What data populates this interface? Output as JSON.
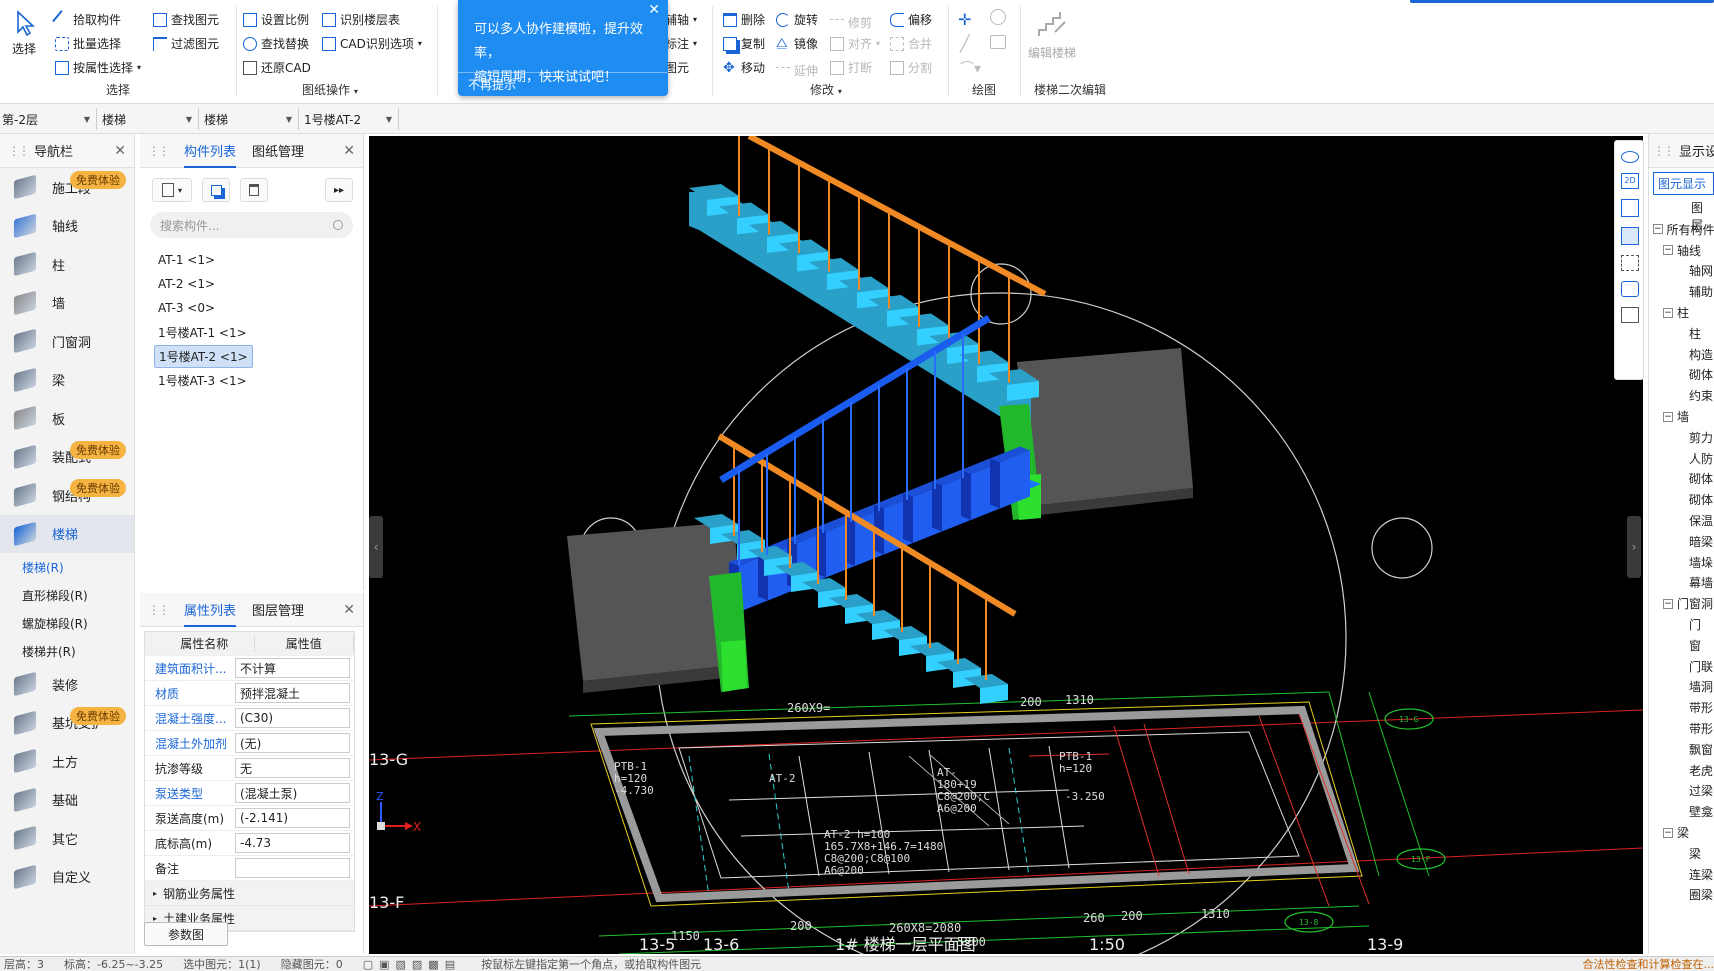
{
  "ribbon": {
    "select": {
      "big": "选择",
      "pick": "拾取构件",
      "batch": "批量选择",
      "by_attr": "按属性选择",
      "find": "查找图元",
      "filter": "过滤图元",
      "group": "选择"
    },
    "drawing": {
      "scale": "设置比例",
      "find_replace": "查找替换",
      "restore_cad": "还原CAD",
      "floor_table": "识别楼层表",
      "cad_options": "CAD识别选项",
      "group": "图纸操作"
    },
    "partial": {
      "axis": "辅轴",
      "dim": "标注",
      "elem": "图元"
    },
    "modify": {
      "delete": "删除",
      "rotate": "旋转",
      "trim": "修剪",
      "offset": "偏移",
      "copy": "复制",
      "mirror": "镜像",
      "align": "对齐",
      "merge": "合并",
      "move": "移动",
      "extend": "延伸",
      "break": "打断",
      "split": "分割",
      "group": "修改"
    },
    "draw": {
      "group": "绘图"
    },
    "stair_edit": {
      "btn": "编辑楼梯",
      "group": "楼梯二次编辑"
    }
  },
  "popup": {
    "line1": "可以多人协作建模啦，提升效率，",
    "line2": "缩短周期，快来试试吧！",
    "dismiss": "不再提示"
  },
  "selectors": [
    "第-2层",
    "楼梯",
    "楼梯",
    "1号楼AT-2"
  ],
  "nav": {
    "title": "导航栏",
    "badge": "免费体验",
    "items": [
      {
        "label": "施工段",
        "badge": true
      },
      {
        "label": "轴线"
      },
      {
        "label": "柱"
      },
      {
        "label": "墙"
      },
      {
        "label": "门窗洞"
      },
      {
        "label": "梁"
      },
      {
        "label": "板"
      },
      {
        "label": "装配式",
        "badge": true
      },
      {
        "label": "钢结构",
        "badge": true
      },
      {
        "label": "楼梯",
        "active": true
      },
      {
        "label": "装修"
      },
      {
        "label": "基坑支护",
        "badge": true
      },
      {
        "label": "土方"
      },
      {
        "label": "基础"
      },
      {
        "label": "其它"
      },
      {
        "label": "自定义"
      }
    ],
    "subitems": [
      "楼梯(R)",
      "直形梯段(R)",
      "螺旋梯段(R)",
      "楼梯井(R)"
    ]
  },
  "components": {
    "tab1": "构件列表",
    "tab2": "图纸管理",
    "search_placeholder": "搜索构件...",
    "items": [
      "AT-1 <1>",
      "AT-2 <1>",
      "AT-3 <0>",
      "1号楼AT-1 <1>",
      "1号楼AT-2 <1>",
      "1号楼AT-3 <1>"
    ],
    "selected_index": 4
  },
  "properties": {
    "tab1": "属性列表",
    "tab2": "图层管理",
    "col_name": "属性名称",
    "col_value": "属性值",
    "rows": [
      {
        "k": "建筑面积计...",
        "v": "不计算",
        "link": true
      },
      {
        "k": "材质",
        "v": "预拌混凝土",
        "link": true
      },
      {
        "k": "混凝土强度...",
        "v": "(C30)",
        "link": true
      },
      {
        "k": "混凝土外加剂",
        "v": "(无)",
        "link": true
      },
      {
        "k": "抗渗等级",
        "v": "无"
      },
      {
        "k": "泵送类型",
        "v": "(混凝土泵)",
        "link": true
      },
      {
        "k": "泵送高度(m)",
        "v": "(-2.141)"
      },
      {
        "k": "底标高(m)",
        "v": "-4.73"
      },
      {
        "k": "备注",
        "v": ""
      }
    ],
    "groups": [
      "钢筋业务属性",
      "土建业务属性"
    ],
    "param_btn": "参数图"
  },
  "viewport": {
    "axis_labels": [
      "13-G",
      "13-F",
      "13-5",
      "13-6",
      "13-9"
    ],
    "dims": [
      "260X9=",
      "200",
      "1310",
      "260X8=2080",
      "1150",
      "200",
      "260",
      "200",
      "1310",
      "5200"
    ],
    "cad_texts": [
      "PTB-1",
      "h=120",
      "-4.730",
      "AT-2",
      "PTB-1",
      "h=120",
      "-3.250",
      "AT-2 h=100",
      "165.7X8+146.7=1480",
      "C8@200;C8@100",
      "A6@200",
      "AT-",
      "180+19",
      "C8@200;C",
      "A6@200"
    ],
    "title_text": "1# 楼梯一层平面图",
    "scale_text": "1:50",
    "bubbles": [
      "13-G",
      "13-F",
      "13-8"
    ],
    "x_axis": "X",
    "z_axis": "Z"
  },
  "display": {
    "title": "显示设置",
    "tab": "图元显示",
    "col": "图层",
    "rows": [
      "所有构件",
      "轴线",
      "轴网",
      "辅助",
      "柱",
      "柱",
      "构造",
      "砌体",
      "约束",
      "墙",
      "剪力",
      "人防",
      "砌体",
      "砌体",
      "保温",
      "暗梁",
      "墙垛",
      "幕墙",
      "门窗洞",
      "门",
      "窗",
      "门联",
      "墙洞",
      "带形",
      "带形",
      "飘窗",
      "老虎",
      "过梁",
      "壁龛",
      "梁",
      "梁",
      "连梁",
      "圈梁"
    ]
  },
  "status": {
    "floor_label": "层高：",
    "floor_val": "3",
    "elev_label": "标高：",
    "elev_val": "-6.25~-3.25",
    "selected": "选中图元：1(1)",
    "hidden": "隐藏图元：0",
    "hint": "按鼠标左键指定第一个角点，或拾取构件图元",
    "check": "合法性检查和计算检查在..."
  },
  "colors": {
    "accent": "#1a66d6",
    "badge": "#f5b342",
    "popup": "#1e8cf0",
    "stair_light": "#2bc4f0",
    "stair_dark": "#1a4fd6",
    "rail_orange": "#f08a24",
    "landing_green": "#22c02e"
  }
}
